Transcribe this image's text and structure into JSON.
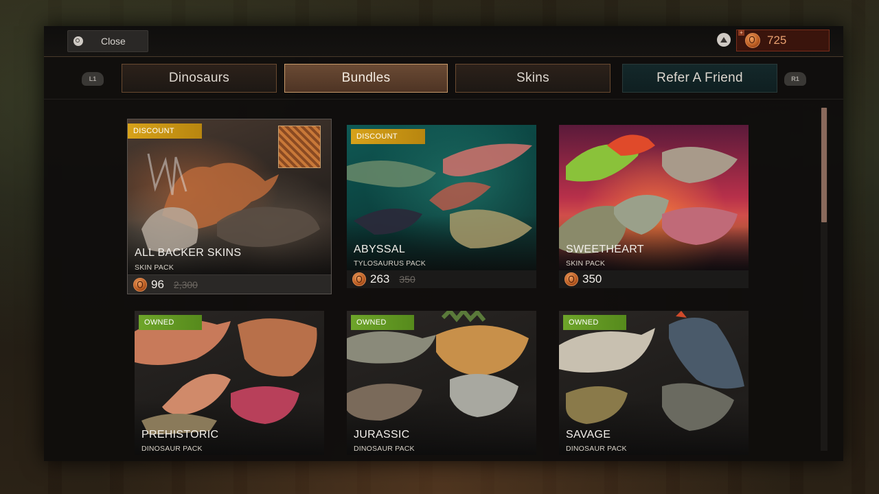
{
  "header": {
    "close_label": "Close",
    "currency_amount": "725"
  },
  "tabs": {
    "left_shoulder": "L1",
    "right_shoulder": "R1",
    "items": [
      "Dinosaurs",
      "Bundles",
      "Skins",
      "Refer A Friend"
    ],
    "active": "Bundles"
  },
  "cards": [
    {
      "badge": "DISCOUNT",
      "title": "ALL BACKER SKINS",
      "subtitle": "SKIN PACK",
      "price": "96",
      "old_price": "2,300"
    },
    {
      "badge": "DISCOUNT",
      "title": "ABYSSAL",
      "subtitle": "TYLOSAURUS PACK",
      "price": "263",
      "old_price": "350"
    },
    {
      "badge": "",
      "title": "SWEETHEART",
      "subtitle": "SKIN PACK",
      "price": "350",
      "old_price": ""
    },
    {
      "badge": "OWNED",
      "title": "PREHISTORIC",
      "subtitle": "DINOSAUR PACK"
    },
    {
      "badge": "OWNED",
      "title": "JURASSIC",
      "subtitle": "DINOSAUR PACK"
    },
    {
      "badge": "OWNED",
      "title": "SAVAGE",
      "subtitle": "DINOSAUR PACK"
    }
  ],
  "colors": {
    "discount_badge": "#d7a21a",
    "owned_badge": "#6ea52a",
    "active_tab": "#6a4a34",
    "currency_bg": "#3a140c"
  },
  "icons": [
    "circle-button-icon",
    "triangle-button-icon",
    "currency-coin-icon"
  ]
}
